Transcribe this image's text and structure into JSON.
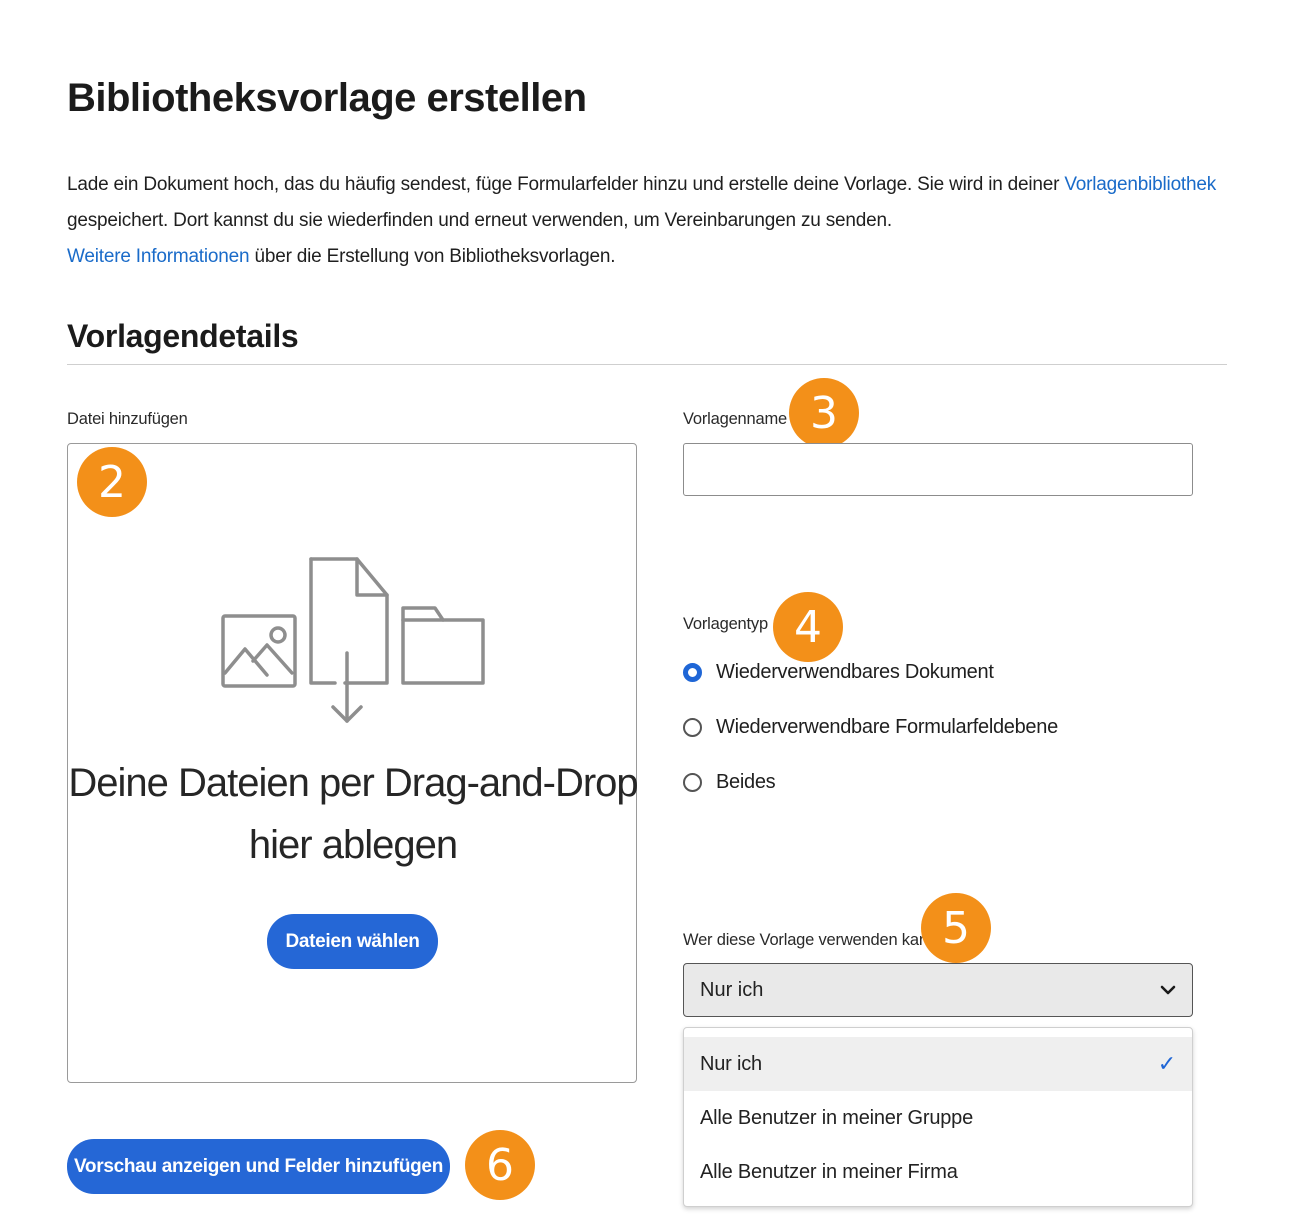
{
  "page": {
    "title": "Bibliotheksvorlage erstellen",
    "intro_text_1": "Lade ein Dokument hoch, das du häufig sendest, füge Formularfelder hinzu und erstelle deine Vorlage. Sie wird in deiner ",
    "intro_link_1": "Vorlagenbibliothek",
    "intro_text_2": "gespeichert. Dort kannst du sie wiederfinden und erneut verwenden, um Vereinbarungen zu senden.",
    "intro_link_2": "Weitere Informationen",
    "intro_text_3": " über die Erstellung von Bibliotheksvorlagen."
  },
  "section": {
    "title": "Vorlagendetails"
  },
  "file_upload": {
    "label": "Datei hinzufügen",
    "drop_text_line1": "Deine Dateien per Drag-and-Drop",
    "drop_text_line2": "hier ablegen",
    "choose_button": "Dateien wählen"
  },
  "template_name": {
    "label": "Vorlagenname",
    "value": ""
  },
  "template_type": {
    "label": "Vorlagentyp",
    "options": [
      {
        "label": "Wiederverwendbares Dokument",
        "selected": true
      },
      {
        "label": "Wiederverwendbare Formularfeldebene",
        "selected": false
      },
      {
        "label": "Beides",
        "selected": false
      }
    ]
  },
  "usage": {
    "label": "Wer diese Vorlage verwenden kann",
    "selected": "Nur ich",
    "options": [
      "Nur ich",
      "Alle Benutzer in meiner Gruppe",
      "Alle Benutzer in meiner Firma"
    ],
    "checkmark": "✓"
  },
  "footer": {
    "preview_button": "Vorschau anzeigen und Felder hinzufügen"
  },
  "badges": [
    "2",
    "3",
    "4",
    "5",
    "6"
  ],
  "colors": {
    "accent": "#2567d6",
    "link": "#1a6bc9",
    "badge": "#f39019",
    "selected_row": "#efefef"
  }
}
